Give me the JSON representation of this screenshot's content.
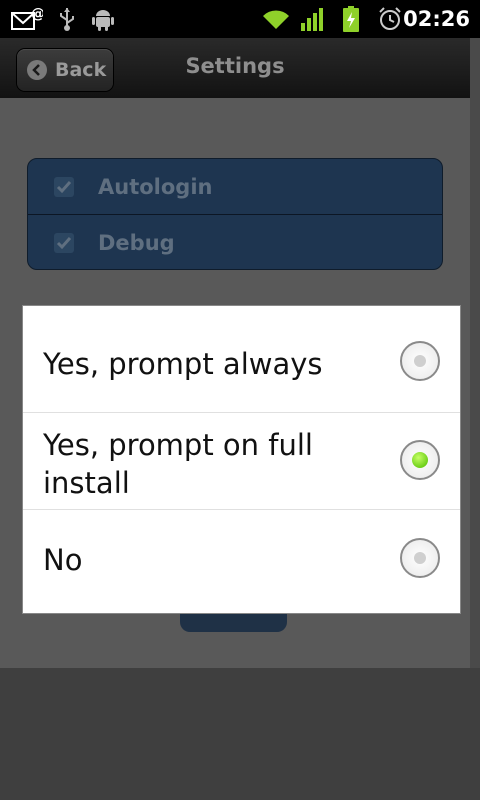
{
  "status_bar": {
    "time": "02:26",
    "icons": [
      "mail-at-icon",
      "usb-icon",
      "android-debug-icon",
      "wifi-icon",
      "signal-icon",
      "battery-charging-icon",
      "alarm-icon"
    ]
  },
  "title_bar": {
    "back_label": "Back",
    "title": "Settings"
  },
  "settings": {
    "items": [
      {
        "label": "Autologin",
        "checked": true
      },
      {
        "label": "Debug",
        "checked": true
      }
    ]
  },
  "dialog": {
    "options": [
      {
        "label": "Yes, prompt always",
        "selected": false
      },
      {
        "label": "Yes, prompt on full install",
        "selected": true
      },
      {
        "label": "No",
        "selected": false
      }
    ]
  },
  "colors": {
    "status_bar": "#000000",
    "group_bg": "#1e3550",
    "radio_selected": "#7ad020",
    "wifi_signal": "#8fd12a"
  }
}
